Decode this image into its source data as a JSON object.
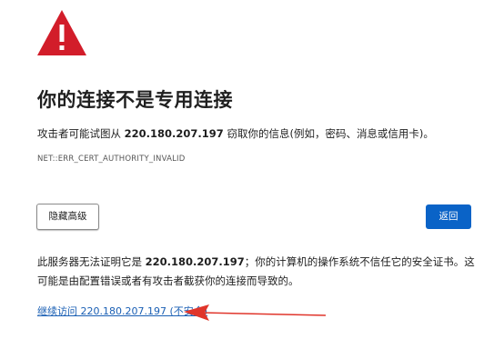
{
  "icons": {
    "warning": "warning-triangle-icon"
  },
  "colors": {
    "warning_red": "#d21d2a",
    "primary_blue": "#0a63c7",
    "link_blue": "#1a5fb4",
    "annotation_arrow": "#e0352b"
  },
  "title": "你的连接不是专用连接",
  "description": {
    "prefix": "攻击者可能试图从 ",
    "host": "220.180.207.197",
    "suffix": " 窃取你的信息(例如，密码、消息或信用卡)。"
  },
  "error_code": "NET::ERR_CERT_AUTHORITY_INVALID",
  "buttons": {
    "hide_advanced": "隐藏高级",
    "back": "返回"
  },
  "details": {
    "prefix": "此服务器无法证明它是 ",
    "host": "220.180.207.197",
    "suffix": "；你的计算机的操作系统不信任它的安全证书。这可能是由配置错误或者有攻击者截获你的连接而导致的。"
  },
  "proceed_link": "继续访问 220.180.207.197 (不安全)"
}
